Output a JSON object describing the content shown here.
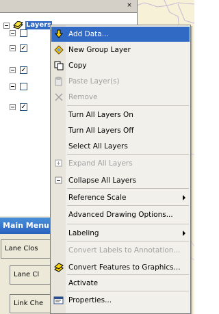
{
  "toc": {
    "root_label": "Layers",
    "layers": [
      {
        "checked": false
      },
      {
        "checked": true
      },
      {
        "checked": true
      },
      {
        "checked": false
      },
      {
        "checked": true
      }
    ],
    "close_glyph": "×"
  },
  "main_menu": {
    "title": "Main Menu",
    "buttons": [
      "Lane Clos",
      "Lane Cl",
      "Link Che"
    ]
  },
  "context_menu": {
    "items": [
      {
        "label": "Add Data...",
        "icon": "add-data-icon",
        "selected": true,
        "disabled": false
      },
      {
        "label": "New Group Layer",
        "icon": "new-group-layer-icon",
        "selected": false,
        "disabled": false
      },
      {
        "label": "Copy",
        "icon": "copy-icon",
        "selected": false,
        "disabled": false
      },
      {
        "label": "Paste Layer(s)",
        "icon": "paste-icon",
        "selected": false,
        "disabled": true
      },
      {
        "label": "Remove",
        "icon": "remove-icon",
        "selected": false,
        "disabled": true
      },
      {
        "label": "Turn All Layers On",
        "icon": "",
        "selected": false,
        "disabled": false
      },
      {
        "label": "Turn All Layers Off",
        "icon": "",
        "selected": false,
        "disabled": false
      },
      {
        "label": "Select All Layers",
        "icon": "",
        "selected": false,
        "disabled": false
      },
      {
        "label": "Expand All Layers",
        "icon": "expand-icon",
        "selected": false,
        "disabled": true
      },
      {
        "label": "Collapse All Layers",
        "icon": "collapse-icon",
        "selected": false,
        "disabled": false
      },
      {
        "label": "Reference Scale",
        "icon": "",
        "selected": false,
        "disabled": false,
        "submenu": true
      },
      {
        "label": "Advanced Drawing Options...",
        "icon": "",
        "selected": false,
        "disabled": false
      },
      {
        "label": "Labeling",
        "icon": "",
        "selected": false,
        "disabled": false,
        "submenu": true
      },
      {
        "label": "Convert Labels to Annotation...",
        "icon": "",
        "selected": false,
        "disabled": true
      },
      {
        "label": "Convert Features to Graphics...",
        "icon": "convert-features-icon",
        "selected": false,
        "disabled": false
      },
      {
        "label": "Activate",
        "icon": "",
        "selected": false,
        "disabled": false
      },
      {
        "label": "Properties...",
        "icon": "properties-icon",
        "selected": false,
        "disabled": false
      }
    ]
  }
}
